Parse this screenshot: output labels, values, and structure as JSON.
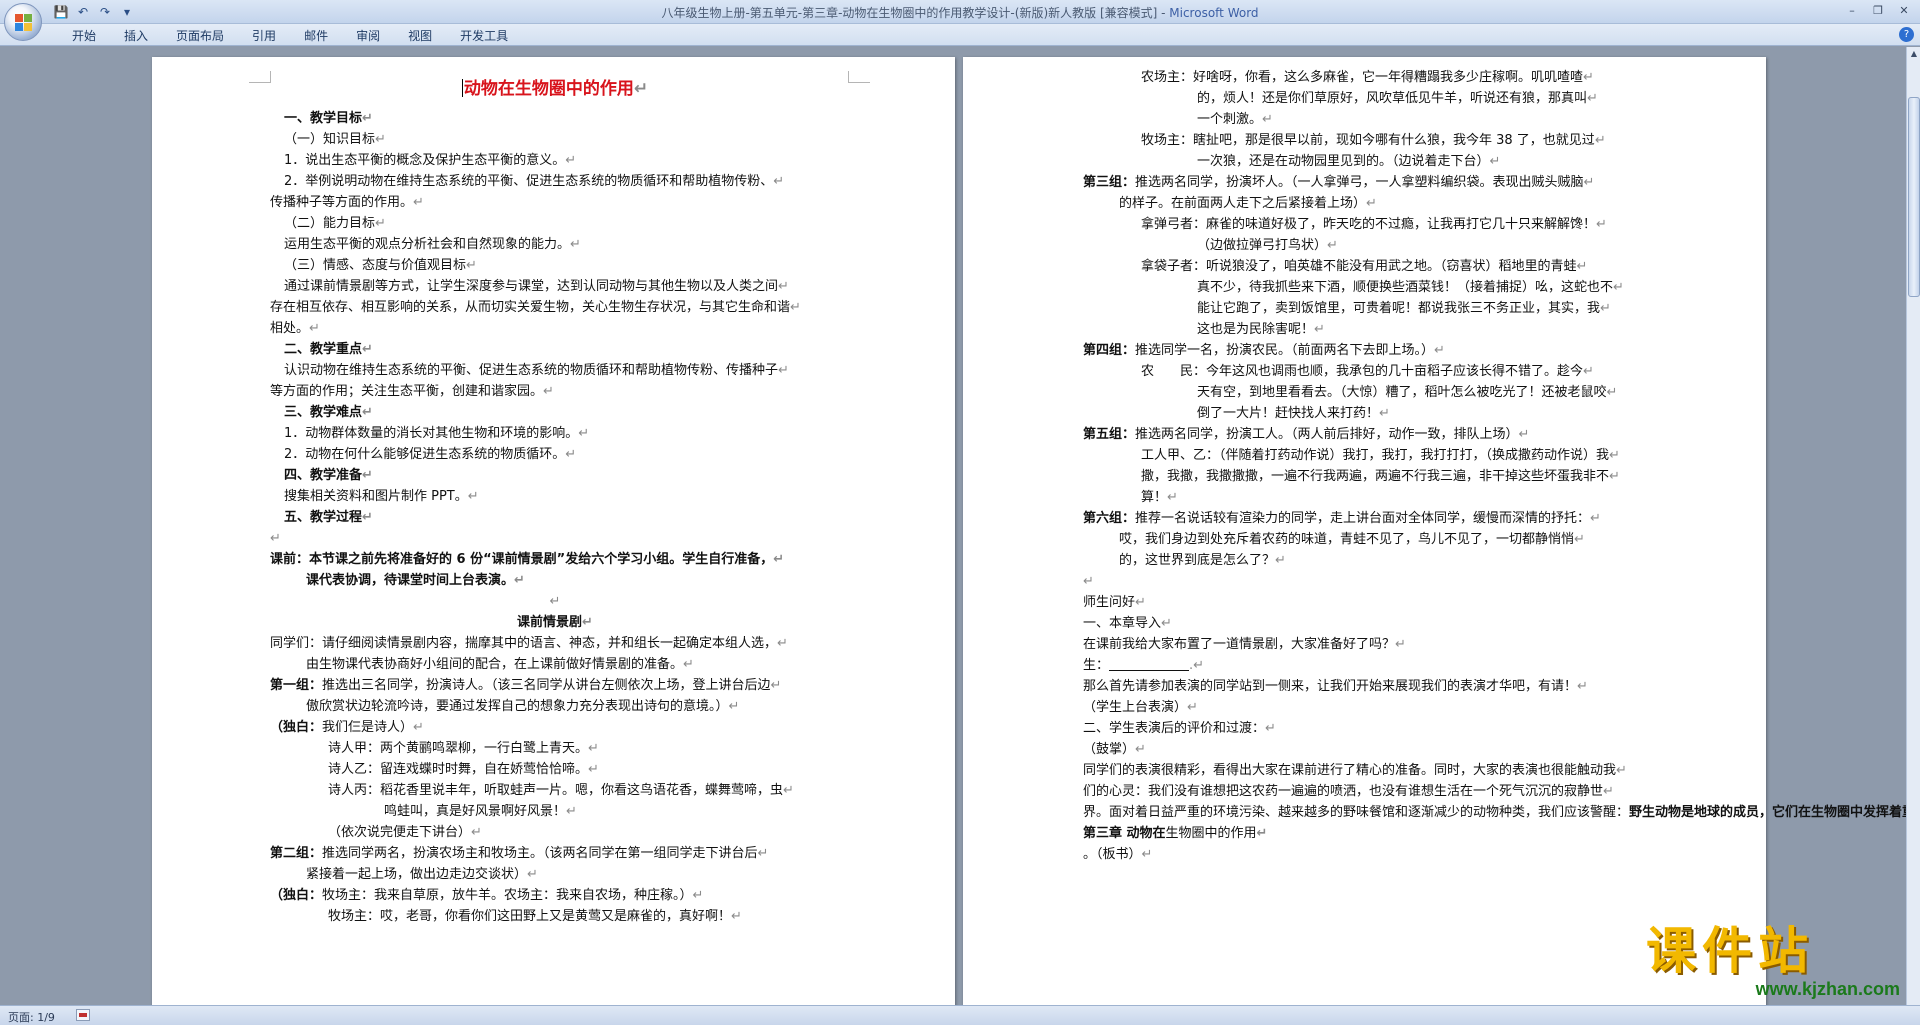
{
  "window": {
    "title": "八年级生物上册-第五单元-第三章-动物在生物圈中的作用教学设计-(新版)新人教版 [兼容模式] - ",
    "app_name": "Microsoft Word",
    "minimize": "–",
    "restore": "❐",
    "close": "✕"
  },
  "qat": {
    "save": "💾",
    "undo": "↶",
    "redo": "↷",
    "customize": "▾"
  },
  "ribbon": {
    "tabs": [
      "开始",
      "插入",
      "页面布局",
      "引用",
      "邮件",
      "审阅",
      "视图",
      "开发工具"
    ],
    "help": "?"
  },
  "page1": {
    "title": "动物在生物圈中的作用",
    "lines": [
      "一、教学目标",
      "（一）知识目标",
      "1．说出生态平衡的概念及保护生态平衡的意义。",
      "2．举例说明动物在维持生态系统的平衡、促进生态系统的物质循环和帮助植物传粉、",
      "传播种子等方面的作用。",
      "（二）能力目标",
      "运用生态平衡的观点分析社会和自然现象的能力。",
      "（三）情感、态度与价值观目标",
      "通过课前情景剧等方式，让学生深度参与课堂，达到认同动物与其他生物以及人类之间",
      "存在相互依存、相互影响的关系，从而切实关爱生物，关心生物生存状况，与其它生命和谐",
      "相处。",
      "二、教学重点",
      "认识动物在维持生态系统的平衡、促进生态系统的物质循环和帮助植物传粉、传播种子",
      "等方面的作用；关注生态平衡，创建和谐家园。",
      "三、教学难点",
      "1．动物群体数量的消长对其他生物和环境的影响。",
      "2．动物在何什么能够促进生态系统的物质循环。",
      "四、教学准备",
      "搜集相关资料和图片制作 PPT。",
      "五、教学过程",
      "",
      "课前：本节课之前先将准备好的 6 份“课前情景剧”发给六个学习小组。学生自行准备，",
      "课代表协调，待课堂时间上台表演。",
      "",
      "课前情景剧",
      "同学们：请仔细阅读情景剧内容，揣摩其中的语言、神态，并和组长一起确定本组人选，",
      "由生物课代表协商好小组间的配合，在上课前做好情景剧的准备。",
      "第一组：推选出三名同学，扮演诗人。（该三名同学从讲台左侧依次上场，登上讲台后边",
      "傲欣赏状边轮流吟诗，要通过发挥自己的想象力充分表现出诗句的意境。）",
      "（独白：我们仨是诗人）",
      "诗人甲：两个黄鹂鸣翠柳，一行白鹭上青天。",
      "诗人乙：留连戏蝶时时舞，自在娇莺恰恰啼。",
      "诗人丙：稻花香里说丰年，听取蛙声一片。嗯，你看这鸟语花香，蝶舞莺啼，虫",
      "鸣蛙叫，真是好风景啊好风景！",
      "（依次说完便走下讲台）",
      "第二组：推选同学两名，扮演农场主和牧场主。（该两名同学在第一组同学走下讲台后",
      "紧接着一起上场，做出边走边交谈状）",
      "（独白：牧场主：我来自草原，放牛羊。农场主：我来自农场，种庄稼。）",
      "牧场主：哎，老哥，你看你们这田野上又是黄莺又是麻雀的，真好啊！"
    ]
  },
  "page2": {
    "lines": [
      "农场主：好啥呀，你看，这么多麻雀，它一年得糟蹋我多少庄稼啊。叽叽喳喳",
      "的，烦人！还是你们草原好，风吹草低见牛羊，听说还有狼，那真叫",
      "一个刺激。",
      "牧场主：瞎扯吧，那是很早以前，现如今哪有什么狼，我今年 38 了，也就见过",
      "一次狼，还是在动物园里见到的。（边说着走下台）",
      "第三组：推选两名同学，扮演坏人。（一人拿弹弓，一人拿塑料编织袋。表现出贼头贼脑",
      "的样子。在前面两人走下之后紧接着上场）",
      "拿弹弓者：麻雀的味道好极了，昨天吃的不过瘾，让我再打它几十只来解解馋！",
      "（边做拉弹弓打鸟状）",
      "拿袋子者：听说狼没了，咱英雄不能没有用武之地。（窃喜状）稻地里的青蛙",
      "真不少，待我抓些来下酒，顺便换些酒菜钱！（接着捕捉）吆，这蛇也不",
      "能让它跑了，卖到饭馆里，可贵着呢！都说我张三不务正业，其实，我",
      "这也是为民除害呢！",
      "第四组：推选同学一名，扮演农民。（前面两名下去即上场。）",
      "农　　民：今年这风也调雨也顺，我承包的几十亩稻子应该长得不错了。趁今",
      "天有空，到地里看看去。（大惊）糟了，稻叶怎么被吃光了！还被老鼠咬",
      "倒了一大片！赶快找人来打药！",
      "第五组：推选两名同学，扮演工人。（两人前后排好，动作一致，排队上场）",
      "工人甲、乙：（伴随着打药动作说）我打，我打，我打打打，（换成撒药动作说）我",
      "撒，我撒，我撒撒撒，一遍不行我两遍，两遍不行我三遍，非干掉这些坏蛋我非不",
      "算！",
      "第六组：推荐一名说话较有渲染力的同学，走上讲台面对全体同学，缓慢而深情的抒托：",
      "哎，我们身边到处充斥着农药的味道，青蛙不见了，鸟儿不见了，一切都静悄悄",
      "的，这世界到底是怎么了？",
      "",
      "师生问好",
      "一、本章导入",
      "在课前我给大家布置了一道情景剧，大家准备好了吗？",
      "生：",
      "那么首先请参加表演的同学站到一侧来，让我们开始来展现我们的表演才华吧，有请！",
      "（学生上台表演）",
      "二、学生表演后的评价和过渡：",
      "（鼓掌）",
      "同学们的表演很精彩，看得出大家在课前进行了精心的准备。同时，大家的表演也很能触动我",
      "们的心灵：我们没有谁想把这农药一遍遍的喷洒，也没有谁想生活在一个死气沉沉的寂静世",
      "界。面对着日益严重的环境污染、越来越多的野味餐馆和逐渐减少的动物种类，我们应该警醒：",
      "野生动物是地球的成员，它们在生物圈中发挥着重要的作用。让我们共同学习",
      "第三章  动物在",
      "生物圈中的作用",
      "。（板书）"
    ]
  },
  "statusbar": {
    "page": "页面: 1/9"
  },
  "watermark": {
    "text": "课件站",
    "url": "www.kjzhan.com"
  }
}
